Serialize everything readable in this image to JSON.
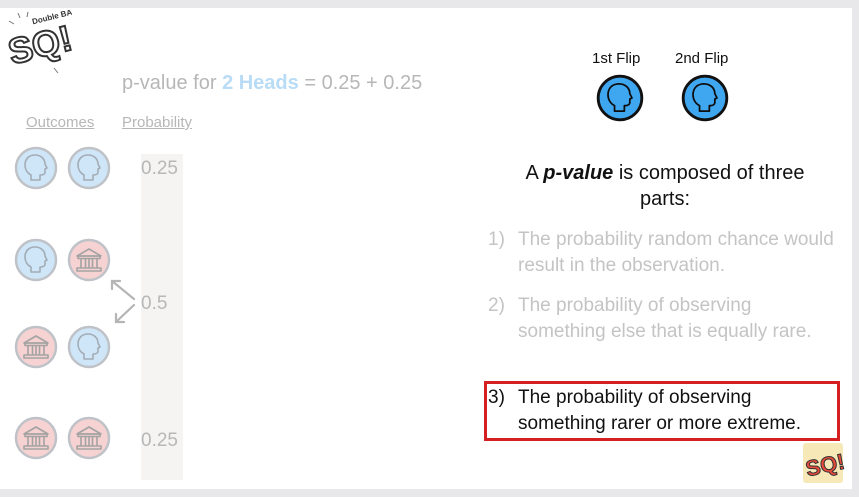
{
  "logo": {
    "text": "SQ!",
    "tagline": "Double BAM!!"
  },
  "pvalue_line": {
    "prefix": "p-value for ",
    "highlight": "2 Heads",
    "suffix": " = 0.25 + 0.25"
  },
  "table": {
    "headers": {
      "outcomes": "Outcomes",
      "probability": "Probability"
    },
    "rows": [
      {
        "outcome": [
          "heads-icon",
          "heads-icon"
        ],
        "probability": "0.25"
      },
      {
        "outcome": [
          "heads-icon",
          "tails-icon"
        ]
      },
      {
        "outcome": [
          "tails-icon",
          "heads-icon"
        ],
        "probability": "0.5"
      },
      {
        "outcome": [
          "tails-icon",
          "tails-icon"
        ],
        "probability": "0.25"
      }
    ]
  },
  "flips": [
    {
      "label": "1st Flip",
      "icon": "heads-icon"
    },
    {
      "label": "2nd Flip",
      "icon": "heads-icon"
    }
  ],
  "description": {
    "prefix": "A ",
    "emphasis": "p-value",
    "suffix": " is composed of three parts:"
  },
  "parts": [
    {
      "number": "1)",
      "text": "The probability random chance would result in the observation."
    },
    {
      "number": "2)",
      "text": "The probability of observing something else that is equally rare."
    },
    {
      "number": "3)",
      "text": "The probability of observing something rarer or more extreme."
    }
  ],
  "colors": {
    "heads_faded": "#cfe6f8",
    "heads_active": "#3fa7f0",
    "tails_faded": "#f6d2d2",
    "highlight_border": "#d42020",
    "faded_text": "#b7b7b7"
  }
}
